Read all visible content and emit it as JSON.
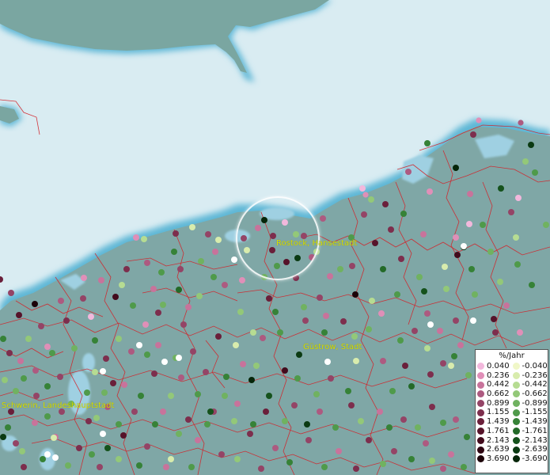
{
  "map": {
    "city_labels": [
      {
        "id": "rostock",
        "text": "Rostock, Hansestadt"
      },
      {
        "id": "guestrow",
        "text": "Güstrow, Stadt"
      },
      {
        "id": "schwerin",
        "text": "Schwerin, Landeshauptstadt"
      }
    ],
    "colors": {
      "sea": "#d9ecf2",
      "land": "#7fa7a6",
      "coast_glow": "#5fb7d6",
      "borders": "#d2232a"
    }
  },
  "legend": {
    "title": "%/Jahr",
    "positive": [
      {
        "label": "0.040",
        "color": "#f2b8dc"
      },
      {
        "label": "0.236",
        "color": "#e08fb8"
      },
      {
        "label": "0.442",
        "color": "#c8739b"
      },
      {
        "label": "0.662",
        "color": "#ad5a80"
      },
      {
        "label": "0.899",
        "color": "#944466"
      },
      {
        "label": "1.155",
        "color": "#7d2e4d"
      },
      {
        "label": "1.439",
        "color": "#6a1f3a"
      },
      {
        "label": "1.761",
        "color": "#56132a"
      },
      {
        "label": "2.143",
        "color": "#420b1c"
      },
      {
        "label": "2.639",
        "color": "#2e0511"
      },
      {
        "label": "3.690",
        "color": "#1c0208"
      }
    ],
    "negative": [
      {
        "label": "-0.040",
        "color": "#f0f7c8"
      },
      {
        "label": "-0.236",
        "color": "#d8ecad"
      },
      {
        "label": "-0.442",
        "color": "#b6dc92"
      },
      {
        "label": "-0.662",
        "color": "#93c878"
      },
      {
        "label": "-0.899",
        "color": "#70b260"
      },
      {
        "label": "-1.155",
        "color": "#4f9a4a"
      },
      {
        "label": "-1.439",
        "color": "#368237"
      },
      {
        "label": "-1.761",
        "color": "#236a28"
      },
      {
        "label": "-2.143",
        "color": "#15521c"
      },
      {
        "label": "-2.639",
        "color": "#0b3a12"
      },
      {
        "label": "-3.690",
        "color": "#052508"
      }
    ]
  }
}
